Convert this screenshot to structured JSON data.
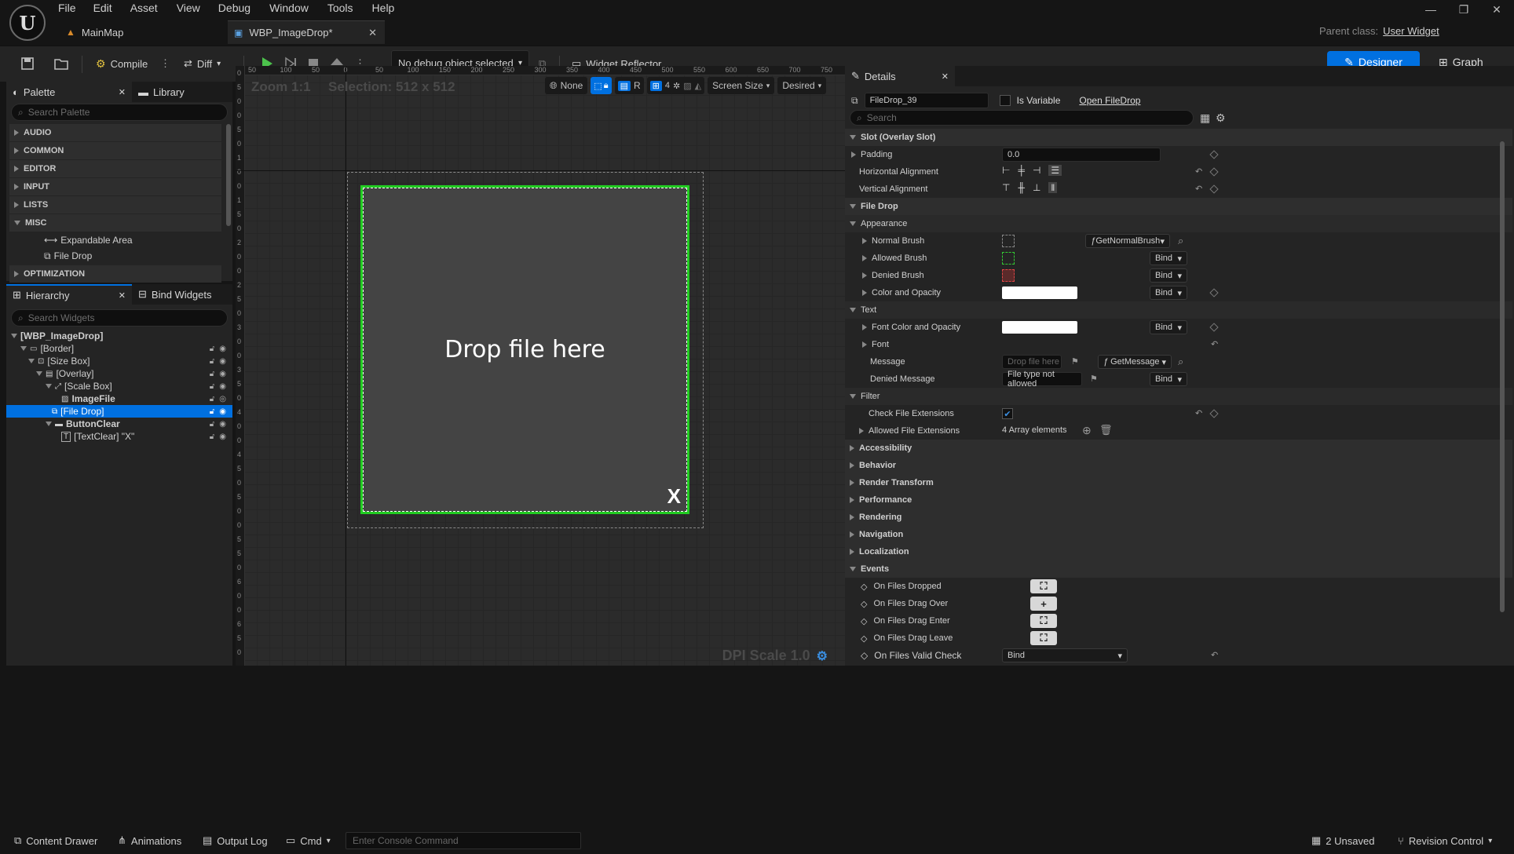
{
  "menu": [
    "File",
    "Edit",
    "Asset",
    "View",
    "Debug",
    "Window",
    "Tools",
    "Help"
  ],
  "tabs": {
    "map": "MainMap",
    "widget": "WBP_ImageDrop*"
  },
  "parent_class": {
    "label": "Parent class:",
    "value": "User Widget"
  },
  "toolbar": {
    "compile": "Compile",
    "diff": "Diff",
    "debug_object": "No debug object selected",
    "widget_reflector": "Widget Reflector",
    "designer": "Designer",
    "graph": "Graph"
  },
  "palette": {
    "tab": "Palette",
    "library_tab": "Library",
    "search_placeholder": "Search Palette",
    "categories": [
      "AUDIO",
      "COMMON",
      "EDITOR",
      "INPUT",
      "LISTS",
      "MISC"
    ],
    "misc_items": [
      "Expandable Area",
      "File Drop"
    ],
    "optimization": "OPTIMIZATION"
  },
  "hierarchy": {
    "tab": "Hierarchy",
    "bind_tab": "Bind Widgets",
    "search_placeholder": "Search Widgets",
    "items": [
      "[WBP_ImageDrop]",
      "[Border]",
      "[Size Box]",
      "[Overlay]",
      "[Scale Box]",
      "ImageFile",
      "[File Drop]",
      "ButtonClear",
      "[TextClear] \"X\""
    ]
  },
  "canvas": {
    "zoom": "Zoom 1:1",
    "selection": "Selection: 512 x 512",
    "none": "None",
    "r": "R",
    "grid_num": "4",
    "screen_size": "Screen Size",
    "desired": "Desired",
    "drop_text": "Drop file here",
    "clear_text": "X",
    "dpi": "DPI Scale 1.0",
    "ruler_h": [
      "50",
      "100",
      "50",
      "0",
      "50",
      "100",
      "150",
      "200",
      "250",
      "300",
      "350",
      "400",
      "450",
      "500",
      "550",
      "600",
      "650",
      "700",
      "750"
    ],
    "ruler_v": [
      "0",
      "5",
      "0",
      "0",
      "5",
      "0",
      "1",
      "0",
      "0",
      "1",
      "5",
      "0",
      "2",
      "0",
      "0",
      "2",
      "5",
      "0",
      "3",
      "0",
      "0",
      "3",
      "5",
      "0",
      "4",
      "0",
      "0",
      "4",
      "5",
      "0",
      "5",
      "0",
      "0",
      "5",
      "5",
      "0",
      "6",
      "0",
      "0",
      "6",
      "5",
      "0"
    ]
  },
  "details": {
    "tab": "Details",
    "name": "FileDrop_39",
    "is_variable": "Is Variable",
    "open": "Open FileDrop",
    "search_placeholder": "Search",
    "slot": "Slot (Overlay Slot)",
    "padding": "Padding",
    "padding_val": "0.0",
    "h_align": "Horizontal Alignment",
    "v_align": "Vertical Alignment",
    "file_drop": "File Drop",
    "appearance": "Appearance",
    "normal_brush": "Normal Brush",
    "normal_fn": "GetNormalBrush",
    "allowed_brush": "Allowed Brush",
    "denied_brush": "Denied Brush",
    "color_opacity": "Color and Opacity",
    "text": "Text",
    "font_color": "Font Color and Opacity",
    "font": "Font",
    "message": "Message",
    "message_ph": "Drop file here",
    "message_fn": "GetMessage",
    "denied_message": "Denied Message",
    "denied_val": "File type not allowed",
    "filter": "Filter",
    "check_ext": "Check File Extensions",
    "allowed_ext": "Allowed File Extensions",
    "array": "4 Array elements",
    "bind": "Bind",
    "sections": [
      "Accessibility",
      "Behavior",
      "Render Transform",
      "Performance",
      "Rendering",
      "Navigation",
      "Localization"
    ],
    "events": "Events",
    "event_items": [
      "On Files Dropped",
      "On Files Drag Over",
      "On Files Drag Enter",
      "On Files Drag Leave"
    ],
    "valid_check": "On Files Valid Check"
  },
  "statusbar": {
    "content": "Content Drawer",
    "animations": "Animations",
    "output": "Output Log",
    "cmd": "Cmd",
    "console_ph": "Enter Console Command",
    "unsaved": "2 Unsaved",
    "revision": "Revision Control"
  }
}
